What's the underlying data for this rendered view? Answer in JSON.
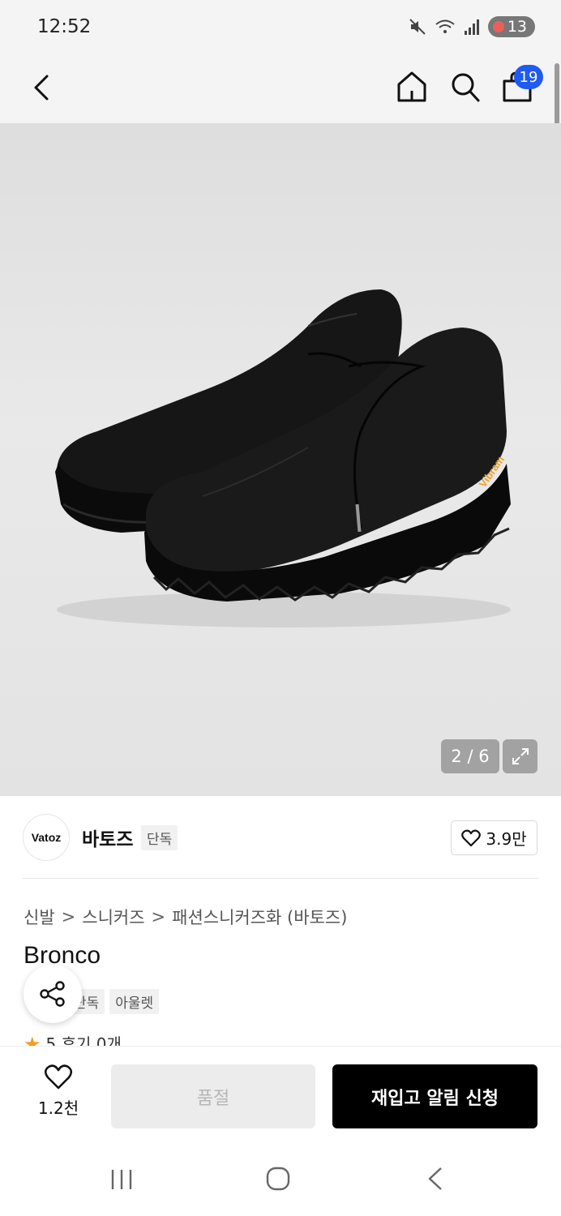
{
  "status_bar": {
    "time": "12:52",
    "battery": "13",
    "icons": [
      "mute-icon",
      "wifi-icon",
      "signal-icon",
      "battery-icon"
    ]
  },
  "header": {
    "icons": [
      "back-icon",
      "home-icon",
      "search-icon",
      "bag-icon"
    ],
    "cart_badge": "19"
  },
  "gallery": {
    "counter": "2 / 6",
    "expand_icon": "expand-icon",
    "midsole_label": "Vibram"
  },
  "brand": {
    "logo_text": "Vatoz",
    "name": "바토즈",
    "tag": "단독",
    "likes": "3.9만"
  },
  "breadcrumb": [
    "신발",
    "스니커즈",
    "패션스니커즈화 (바토즈)"
  ],
  "product": {
    "title": "Bronco",
    "tags": [
      "단독",
      "아울렛"
    ],
    "rating_partial": "5  후기 0개"
  },
  "bottom_bar": {
    "wish_count": "1.2천",
    "soldout_label": "품절",
    "restock_label": "재입고 알림 신청"
  },
  "colors": {
    "accent_blue": "#1f5bf0",
    "star_orange": "#f59a23",
    "primary_black": "#000000"
  },
  "nav_bar": {
    "icons": [
      "recent-apps-icon",
      "home-circle-icon",
      "back-chevron-icon"
    ]
  }
}
